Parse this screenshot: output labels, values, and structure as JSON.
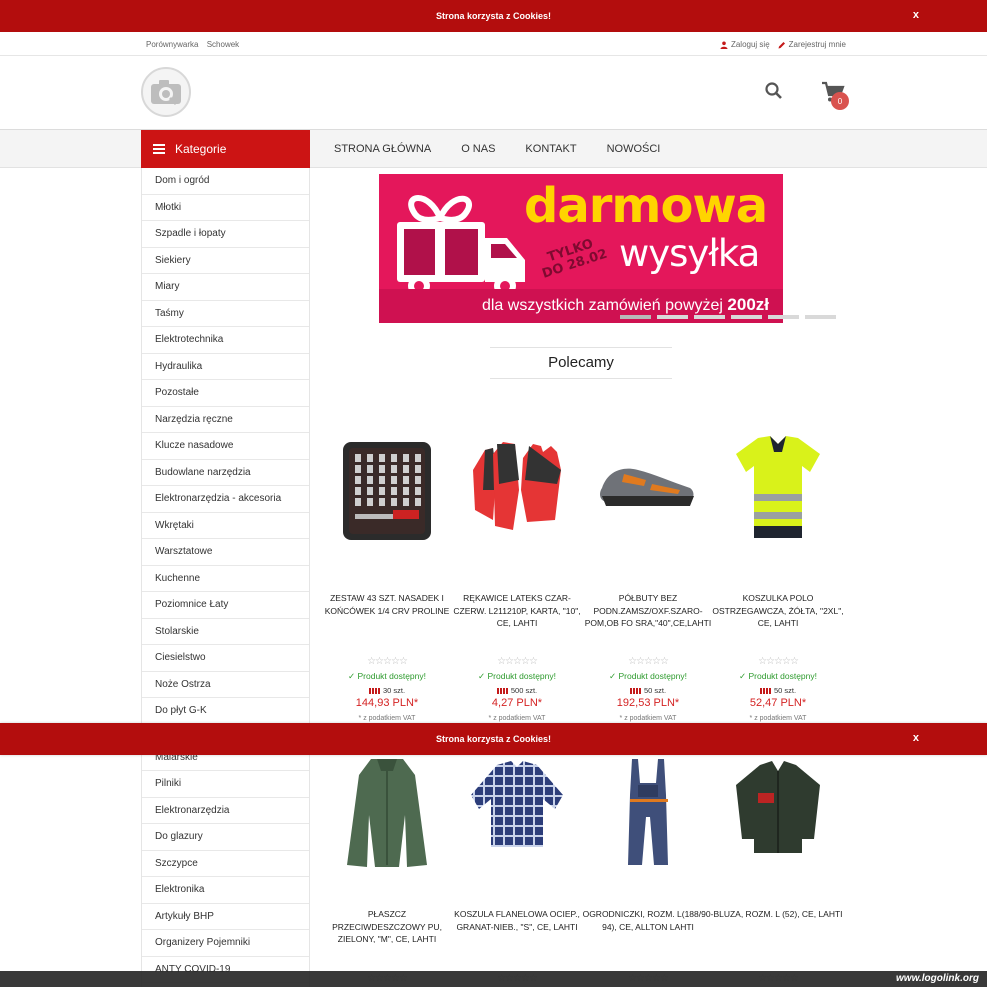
{
  "cookie": {
    "text": "Strona korzysta z Cookies!",
    "close": "x"
  },
  "topbar": {
    "compare": "Porównywarka",
    "clipboard": "Schowek",
    "login": "Zaloguj się",
    "register": "Zarejestruj mnie"
  },
  "cart": {
    "count": "0"
  },
  "nav": {
    "categories_label": "Kategorie",
    "links": [
      "STRONA GŁÓWNA",
      "O NAS",
      "KONTAKT",
      "NOWOŚCI"
    ]
  },
  "sidebar": {
    "categories": [
      "Dom i ogród",
      "Młotki",
      "Szpadle i łopaty",
      "Siekiery",
      "Miary",
      "Taśmy",
      "Elektrotechnika",
      "Hydraulika",
      "Pozostałe",
      "Narzędzia ręczne",
      "Klucze nasadowe",
      "Budowlane narzędzia",
      "Elektronarzędzia - akcesoria",
      "Wkrętaki",
      "Warsztatowe",
      "Kuchenne",
      "Poziomnice Łaty",
      "Stolarskie",
      "Ciesielstwo",
      "Noże Ostrza",
      "Do płyt G-K",
      "Malarskie",
      "Malarskie",
      "Pilniki",
      "Elektronarzędzia",
      "Do glazury",
      "Szczypce",
      "Elektronika",
      "Artykuły BHP",
      "Organizery Pojemniki",
      "ANTY COVID-19"
    ]
  },
  "banner": {
    "line1": "darmowa",
    "line2": "wysyłka",
    "badge_line1": "TYLKO",
    "badge_line2": "DO 28.02",
    "footer": "dla wszystkich zamówień powyżej",
    "amount": "200zł",
    "colors": {
      "background": "#e4175b",
      "headline": "#ffd400"
    }
  },
  "section": {
    "title": "Polecamy"
  },
  "products": [
    {
      "name": "ZESTAW 43 SZT. NASADEK I KOŃCÓWEK 1/4 CRV PROLINE",
      "stars": "☆☆☆☆☆",
      "availability": "Produkt dostępny!",
      "stock": "30 szt.",
      "price": "144,93 PLN*",
      "vat": "* z podatkiem VAT",
      "icon": "socket-set-icon"
    },
    {
      "name": "RĘKAWICE LATEKS CZAR-CZERW. L211210P, KARTA, \"10\", CE, LAHTI",
      "stars": "☆☆☆☆☆",
      "availability": "Produkt dostępny!",
      "stock": "500 szt.",
      "price": "4,27 PLN*",
      "vat": "* z podatkiem VAT",
      "icon": "gloves-icon"
    },
    {
      "name": "PÓŁBUTY BEZ PODN.ZAMSZ/OXF.SZARO-POM,OB FO SRA,\"40\",CE,LAHTI",
      "stars": "☆☆☆☆☆",
      "availability": "Produkt dostępny!",
      "stock": "50 szt.",
      "price": "192,53 PLN*",
      "vat": "* z podatkiem VAT",
      "icon": "shoe-icon"
    },
    {
      "name": "KOSZULKA POLO OSTRZEGAWCZA, ŻÓŁTA, \"2XL\", CE, LAHTI",
      "stars": "☆☆☆☆☆",
      "availability": "Produkt dostępny!",
      "stock": "50 szt.",
      "price": "52,47 PLN*",
      "vat": "* z podatkiem VAT",
      "icon": "polo-shirt-icon"
    },
    {
      "name": "PŁASZCZ PRZECIWDESZCZOWY PU, ZIELONY, \"M\", CE, LAHTI",
      "stars": "☆☆☆☆☆",
      "icon": "raincoat-icon"
    },
    {
      "name": "KOSZULA FLANELOWA OCIEP., GRANAT-NIEB., \"S\", CE, LAHTI",
      "stars": "☆☆☆☆☆",
      "icon": "flannel-shirt-icon"
    },
    {
      "name": "OGRODNICZKI, ROZM. L(188/90-94), CE, ALLTON LAHTI",
      "stars": "☆☆☆☆☆",
      "icon": "overalls-icon"
    },
    {
      "name": "BLUZA, ROZM. L (52), CE, LAHTI",
      "stars": "☆☆☆☆☆",
      "icon": "jacket-icon"
    }
  ],
  "watermark": "www.logolink.org"
}
